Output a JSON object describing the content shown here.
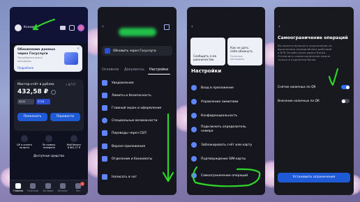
{
  "phone1": {
    "profile_name": "Ксения",
    "promo": {
      "title_line1": "Обновление данных",
      "title_line2": "через Госуслуги",
      "desc_line1": "Потребуется всего",
      "desc_line2": "несколько",
      "link": "Подробнее"
    },
    "account": {
      "title": "Мастер-счёт в рублях",
      "number": "• 8777",
      "balance": "432,58 ₽",
      "card1": "0222",
      "card2": "3718",
      "topup": "Пополнить",
      "transfer": "Перевести"
    },
    "quick_actions": [
      {
        "label_line1": "QR и оплата",
        "label_line2": "по фото"
      },
      {
        "label_line1": "По номеру",
        "label_line2": "телефона"
      },
      {
        "label_line1": "Мой баланс",
        "label_line2": "8 861,27 ₽"
      }
    ],
    "available_funds": "Доступные средства",
    "nav": [
      "Главная",
      "Платежи",
      "История",
      "Каталог",
      "Чат"
    ],
    "chat_badge": "2"
  },
  "phone2": {
    "gosuslugi_button": "Обновить через Госуслуги",
    "tabs": [
      "Основное",
      "Документы",
      "Настройки"
    ],
    "items": [
      "Уведомления",
      "Лимиты и безопасность",
      "Главный экран и оформление",
      "Специальные возможности",
      "Переводы через СБП",
      "Версия приложения",
      "Отделения и банкоматы",
      "Написать в чат"
    ]
  },
  "phone3": {
    "cards": [
      {
        "line1": "Сообщить о мо",
        "line2": "шенничестве"
      },
      {
        "line1": "Как не дать",
        "line2": "себя обмануть",
        "line3": "Полезные",
        "line4": "материалы"
      }
    ],
    "section_title": "Настройки",
    "items": [
      "Вход в приложение",
      "Управление лимитами",
      "Конфиденциальность",
      "Подключить определитель номера",
      "Заблокировать счёт или карту",
      "Подтверждение SIM-карты",
      "Самоограничение операций"
    ]
  },
  "phone4": {
    "title": "Самоограничение операций",
    "description": [
      "Вы можете включить ограничение на",
      "выполнение определённых действий",
      "в ВТБ Онлайн и/или офисе Банка.",
      "Отключить самоограничение можно",
      "только в отделении банка."
    ],
    "toggles": [
      {
        "label": "Снятие наличных по QR",
        "on": true
      },
      {
        "label": "Внесение наличных по QR",
        "on": false
      }
    ],
    "button": "Установить ограничения"
  },
  "colors": {
    "accent": "#1f5ad6",
    "annotation": "#2fd62a",
    "toggle_on": "#2c72ff"
  }
}
